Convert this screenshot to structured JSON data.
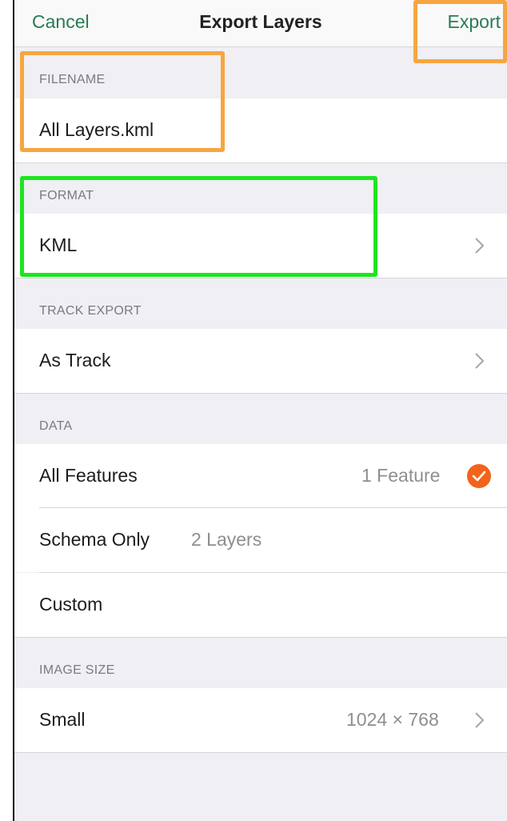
{
  "navbar": {
    "cancel_label": "Cancel",
    "title": "Export Layers",
    "export_label": "Export"
  },
  "filename": {
    "header": "FILENAME",
    "value": "All Layers.kml"
  },
  "format": {
    "header": "FORMAT",
    "value": "KML"
  },
  "track_export": {
    "header": "TRACK EXPORT",
    "value": "As Track"
  },
  "data": {
    "header": "DATA",
    "options": [
      {
        "label": "All Features",
        "detail": "1 Feature",
        "selected": true
      },
      {
        "label": "Schema Only",
        "detail": "2 Layers",
        "selected": false
      },
      {
        "label": "Custom",
        "detail": "",
        "selected": false
      }
    ]
  },
  "image_size": {
    "header": "IMAGE SIZE",
    "label": "Small",
    "value": "1024 × 768"
  },
  "colors": {
    "accent": "#2b7a52",
    "check": "#f2631b",
    "highlight_orange": "#f6a640",
    "highlight_green": "#1ee51e"
  },
  "icons": [
    "chevron-right-icon",
    "checkmark-icon"
  ]
}
